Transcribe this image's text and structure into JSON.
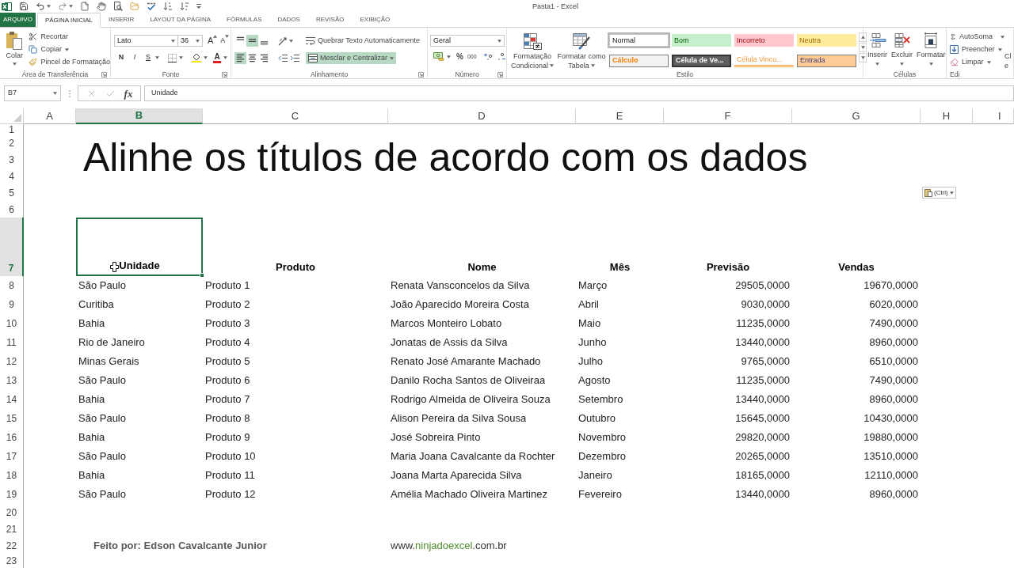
{
  "window": {
    "title": "Pasta1 - Excel"
  },
  "tabs": [
    {
      "label": "ARQUIVO",
      "kind": "file",
      "selected": false
    },
    {
      "label": "PÁGINA INICIAL",
      "kind": "tab",
      "selected": true
    },
    {
      "label": "INSERIR",
      "kind": "tab",
      "selected": false
    },
    {
      "label": "LAYOUT DA PÁGINA",
      "kind": "tab",
      "selected": false
    },
    {
      "label": "FÓRMULAS",
      "kind": "tab",
      "selected": false
    },
    {
      "label": "DADOS",
      "kind": "tab",
      "selected": false
    },
    {
      "label": "REVISÃO",
      "kind": "tab",
      "selected": false
    },
    {
      "label": "EXIBIÇÃO",
      "kind": "tab",
      "selected": false
    }
  ],
  "clipboard": {
    "label": "Área de Transferência",
    "paste": "Colar",
    "cut": "Recortar",
    "copy": "Copiar",
    "format_painter": "Pincel de Formatação"
  },
  "font": {
    "label": "Fonte",
    "family": "Lato",
    "size": "36",
    "grow": "A",
    "shrink": "A",
    "bold": "N",
    "italic": "I",
    "underline": "S",
    "color_letter": "A"
  },
  "alignment": {
    "label": "Alinhamento",
    "vertical": [
      {
        "kind": "top",
        "selected": false
      },
      {
        "kind": "middle",
        "selected": true
      },
      {
        "kind": "bottom",
        "selected": false
      }
    ],
    "horizontal": [
      {
        "kind": "left",
        "selected": true
      },
      {
        "kind": "center",
        "selected": false
      },
      {
        "kind": "right",
        "selected": false
      }
    ],
    "wrap_text": "Quebrar Texto Automaticamente",
    "merge": {
      "label": "Mesclar e Centralizar",
      "selected": true
    }
  },
  "number": {
    "label": "Número",
    "format": "Geral",
    "percent": "%",
    "thousands": "000"
  },
  "styles": {
    "label": "Estilo",
    "conditional": [
      "Formatação",
      "Condicional"
    ],
    "format_table": [
      "Formatar como",
      "Tabela"
    ],
    "gallery": [
      {
        "label": "Normal",
        "kind": "normal",
        "selected": true
      },
      {
        "label": "Bom",
        "kind": "good",
        "selected": false
      },
      {
        "label": "Incorreto",
        "kind": "bad",
        "selected": false
      },
      {
        "label": "Neutra",
        "kind": "neutral",
        "selected": false
      },
      {
        "label": "Cálculo",
        "kind": "calc",
        "selected": false
      },
      {
        "label": "Célula de Ve...",
        "kind": "check",
        "selected": false
      },
      {
        "label": "Célula Vincu...",
        "kind": "linked",
        "selected": false
      },
      {
        "label": "Entrada",
        "kind": "input",
        "selected": false
      }
    ]
  },
  "cells": {
    "label": "Células",
    "buttons": [
      {
        "label": "Inserir",
        "kind": "insert"
      },
      {
        "label": "Excluir",
        "kind": "delete"
      },
      {
        "label": "Formatar",
        "kind": "format"
      }
    ]
  },
  "editing": {
    "label": "Edi",
    "autosum": "AutoSoma",
    "fill": "Preencher",
    "clear": "Limpar",
    "cut_off_button": [
      "Cl",
      "e"
    ]
  },
  "formula_bar": {
    "name_box": "B7",
    "function_button": "fx",
    "formula": "Unidade"
  },
  "sheet": {
    "columns": [
      {
        "label": "A",
        "selected": false
      },
      {
        "label": "B",
        "selected": true
      },
      {
        "label": "C",
        "selected": false
      },
      {
        "label": "D",
        "selected": false
      },
      {
        "label": "E",
        "selected": false
      },
      {
        "label": "F",
        "selected": false
      },
      {
        "label": "G",
        "selected": false
      },
      {
        "label": "H",
        "selected": false
      },
      {
        "label": "I",
        "selected": false
      }
    ],
    "rows": [
      {
        "label": "1",
        "selected": false
      },
      {
        "label": "2",
        "selected": false
      },
      {
        "label": "3",
        "selected": false
      },
      {
        "label": "4",
        "selected": false
      },
      {
        "label": "5",
        "selected": false
      },
      {
        "label": "6",
        "selected": false
      },
      {
        "label": "7",
        "selected": true
      },
      {
        "label": "8",
        "selected": false
      },
      {
        "label": "9",
        "selected": false
      },
      {
        "label": "10",
        "selected": false
      },
      {
        "label": "11",
        "selected": false
      },
      {
        "label": "12",
        "selected": false
      },
      {
        "label": "13",
        "selected": false
      },
      {
        "label": "14",
        "selected": false
      },
      {
        "label": "15",
        "selected": false
      },
      {
        "label": "16",
        "selected": false
      },
      {
        "label": "17",
        "selected": false
      },
      {
        "label": "18",
        "selected": false
      },
      {
        "label": "19",
        "selected": false
      },
      {
        "label": "20",
        "selected": false
      },
      {
        "label": "21",
        "selected": false
      },
      {
        "label": "22",
        "selected": false
      },
      {
        "label": "23",
        "selected": false
      }
    ],
    "title": "Alinhe os títulos de acordo com os dados",
    "paste_options": "(Ctrl)",
    "header": [
      {
        "text": "Unidade",
        "selected": true
      },
      {
        "text": "Produto",
        "selected": false
      },
      {
        "text": "Nome",
        "selected": false
      },
      {
        "text": "Mês",
        "selected": false
      },
      {
        "text": "Previsão",
        "selected": false
      },
      {
        "text": "Vendas",
        "selected": false
      }
    ],
    "data": [
      [
        "São Paulo",
        "Produto 1",
        "Renata Vansconcelos da Silva",
        "Março",
        "29505,0000",
        "19670,0000"
      ],
      [
        "Curitiba",
        "Produto 2",
        "João Aparecido Moreira Costa",
        "Abril",
        "9030,0000",
        "6020,0000"
      ],
      [
        "Bahia",
        "Produto 3",
        "Marcos Monteiro Lobato",
        "Maio",
        "11235,0000",
        "7490,0000"
      ],
      [
        "Rio de Janeiro",
        "Produto 4",
        "Jonatas de Assis da Silva",
        "Junho",
        "13440,0000",
        "8960,0000"
      ],
      [
        "Minas Gerais",
        "Produto 5",
        "Renato José Amarante Machado",
        "Julho",
        "9765,0000",
        "6510,0000"
      ],
      [
        "São Paulo",
        "Produto 6",
        "Danilo Rocha Santos de Oliveiraa",
        "Agosto",
        "11235,0000",
        "7490,0000"
      ],
      [
        "Bahia",
        "Produto 7",
        "Rodrigo Almeida de Oliveira Souza",
        "Setembro",
        "13440,0000",
        "8960,0000"
      ],
      [
        "São Paulo",
        "Produto 8",
        "Alison Pereira da Silva Sousa",
        "Outubro",
        "15645,0000",
        "10430,0000"
      ],
      [
        "Bahia",
        "Produto 9",
        "José Sobreira Pinto",
        "Novembro",
        "29820,0000",
        "19880,0000"
      ],
      [
        "São Paulo",
        "Produto 10",
        "Maria Joana Cavalcante da Rochter",
        "Dezembro",
        "20265,0000",
        "13510,0000"
      ],
      [
        "Bahia",
        "Produto 11",
        "Joana Marta Aparecida Silva",
        "Janeiro",
        "18165,0000",
        "12110,0000"
      ],
      [
        "São Paulo",
        "Produto 12",
        "Amélia Machado Oliveira Martinez",
        "Fevereiro",
        "13440,0000",
        "8960,0000"
      ]
    ],
    "footer": {
      "author": "Feito por: Edson Cavalcante Junior",
      "website": {
        "prefix": "www.",
        "name": "ninjadoexcel",
        "suffix": ".com.br"
      }
    }
  }
}
